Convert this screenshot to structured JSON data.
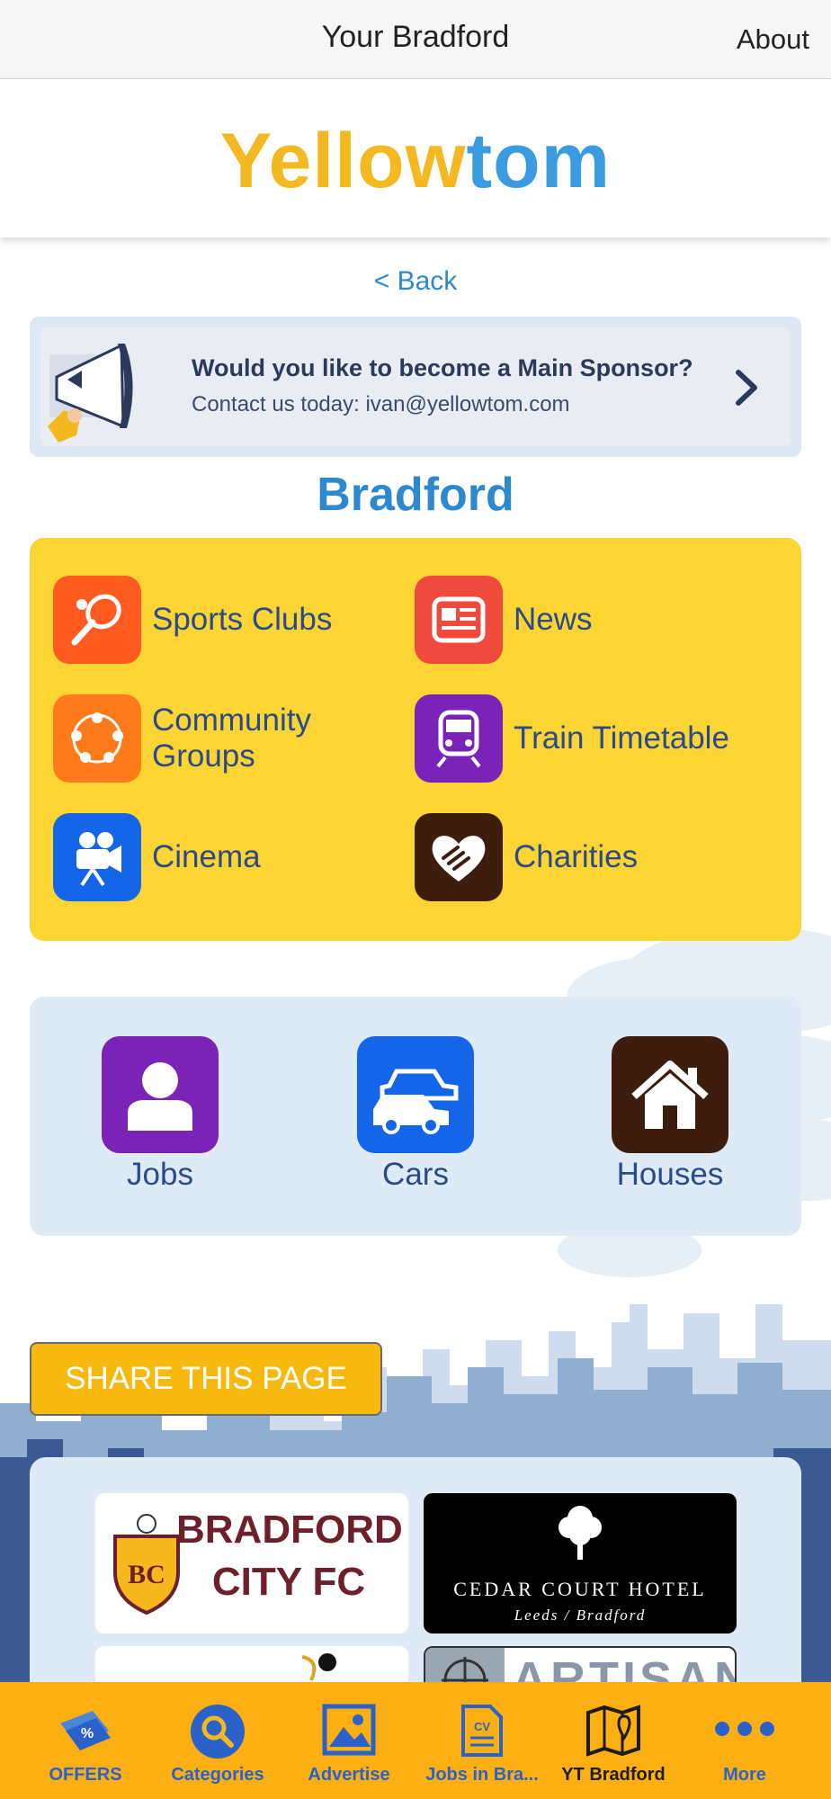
{
  "nav": {
    "title": "Your Bradford",
    "about": "About"
  },
  "logo": {
    "part1": "Yellow",
    "part2": "tom"
  },
  "back_label": "< Back",
  "sponsor": {
    "title": "Would you like to become a Main Sponsor?",
    "subtitle": "Contact us today: ivan@yellowtom.com"
  },
  "city_title": "Bradford",
  "categories": [
    {
      "label": "Sports Clubs",
      "icon": "tennis-racket-icon",
      "color": "#ff5a1f"
    },
    {
      "label": "News",
      "icon": "newspaper-icon",
      "color": "#f04a3e"
    },
    {
      "label": "Community Groups",
      "icon": "community-icon",
      "color": "#ff7a1a"
    },
    {
      "label": "Train Timetable",
      "icon": "train-icon",
      "color": "#7b22b7"
    },
    {
      "label": "Cinema",
      "icon": "film-camera-icon",
      "color": "#1565e8"
    },
    {
      "label": "Charities",
      "icon": "heart-hands-icon",
      "color": "#3d1d0e"
    }
  ],
  "quick_links": [
    {
      "label": "Jobs",
      "icon": "person-icon",
      "color": "#7b22b7"
    },
    {
      "label": "Cars",
      "icon": "cars-icon",
      "color": "#1565e8"
    },
    {
      "label": "Houses",
      "icon": "house-icon",
      "color": "#3d1d0e"
    }
  ],
  "share_label": "SHARE THIS PAGE",
  "sponsor_logos": [
    {
      "line1": "BRADFORD",
      "line2": "CITY FC",
      "badge": "BC"
    },
    {
      "line1": "CEDAR COURT HOTEL",
      "line2": "Leeds / Bradford"
    },
    {
      "line1": "ARTISAN"
    }
  ],
  "tabs": [
    {
      "label": "OFFERS",
      "icon": "offers-tag-icon"
    },
    {
      "label": "Categories",
      "icon": "search-icon"
    },
    {
      "label": "Advertise",
      "icon": "picture-icon"
    },
    {
      "label": "Jobs in Bra...",
      "icon": "cv-document-icon"
    },
    {
      "label": "YT Bradford",
      "icon": "map-pin-icon"
    },
    {
      "label": "More",
      "icon": "more-dots-icon"
    }
  ],
  "colors": {
    "accent_blue": "#2d89cf",
    "yellow_panel": "#fcd433",
    "tabbar": "#fbaf13",
    "label_navy": "#2a4a8a"
  }
}
